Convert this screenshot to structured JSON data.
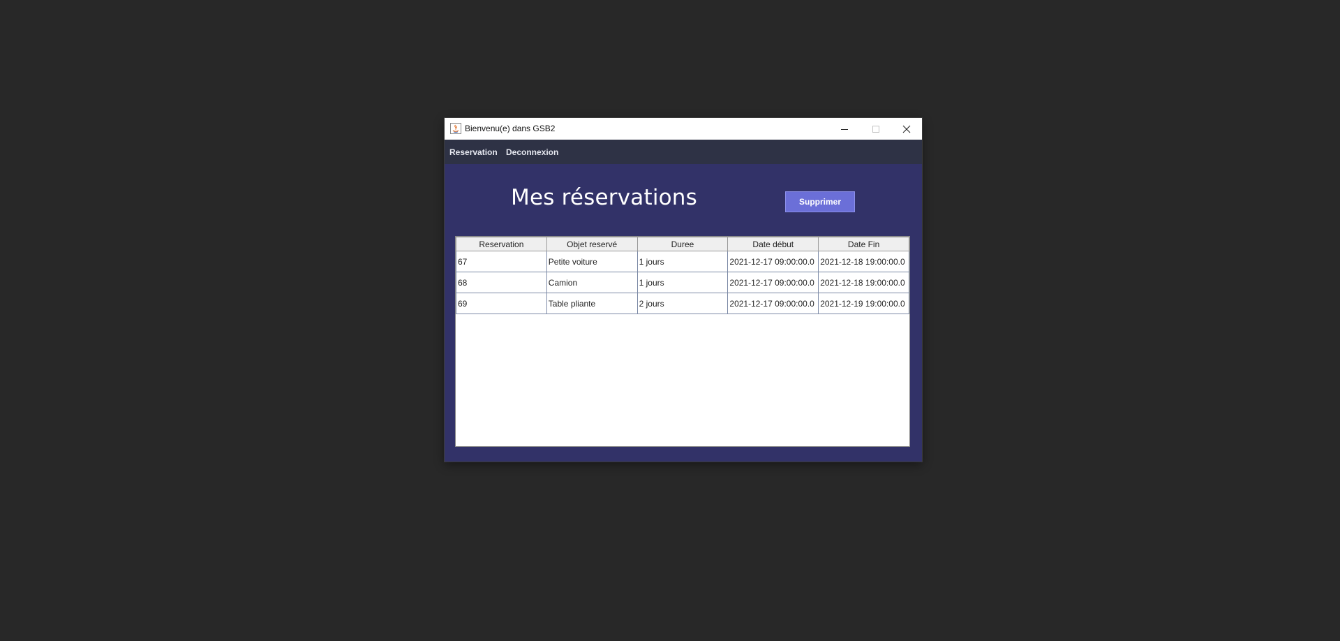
{
  "window": {
    "title": "Bienvenu(e) dans GSB2",
    "icon": "java-app-icon"
  },
  "menu": {
    "items": [
      {
        "label": "Reservation"
      },
      {
        "label": "Deconnexion"
      }
    ]
  },
  "page": {
    "title": "Mes réservations",
    "delete_label": "Supprimer"
  },
  "table": {
    "columns": [
      "Reservation",
      "Objet reservé",
      "Duree",
      "Date début",
      "Date Fin"
    ],
    "rows": [
      [
        "67",
        "Petite voiture",
        "1 jours",
        "2021-12-17 09:00:00.0",
        "2021-12-18 19:00:00.0"
      ],
      [
        "68",
        "Camion",
        "1 jours",
        "2021-12-17 09:00:00.0",
        "2021-12-18 19:00:00.0"
      ],
      [
        "69",
        "Table pliante",
        "2 jours",
        "2021-12-17 09:00:00.0",
        "2021-12-19 19:00:00.0"
      ]
    ]
  },
  "colors": {
    "desktop": "#282828",
    "content_bg": "#323268",
    "menubar_bg": "#2e3245",
    "button_bg": "#6b6fd8"
  }
}
